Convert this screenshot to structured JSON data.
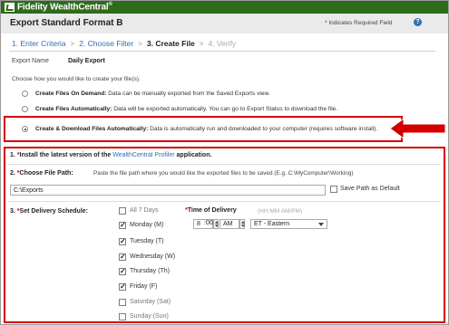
{
  "app": {
    "brand": "Fidelity WealthCentral",
    "brand_suffix": "®"
  },
  "page": {
    "title": "Export Standard Format B",
    "required_note": "Indicates Required Field",
    "help_icon": "?"
  },
  "steps": [
    {
      "label": "1. Enter Criteria",
      "state": "done"
    },
    {
      "label": "2. Choose Filter",
      "state": "done"
    },
    {
      "label": "3. Create File",
      "state": "current"
    },
    {
      "label": "4. Verify",
      "state": "future"
    }
  ],
  "export_name": {
    "label": "Export Name",
    "value": "Daily Export"
  },
  "choose_prompt": "Choose how you would like to create your file(s).",
  "options": [
    {
      "title": "Create Files On Demand:",
      "text": "Data can be manually exported from the Saved Exports view.",
      "selected": false
    },
    {
      "title": "Create Files Automatically:",
      "text": "Data will be exported automatically. You can go to Export Status to download the file.",
      "selected": false
    },
    {
      "title": "Create & Download Files Automatically:",
      "text": "Data is automatically run and downloaded to your computer (requires software install).",
      "selected": true
    }
  ],
  "step1": {
    "num": "1.",
    "text_a": "Install the latest version of the",
    "link": "WealthCentral Profiler",
    "text_b": "application."
  },
  "step2": {
    "num": "2.",
    "label": "Choose File Path:",
    "help": "Paste the file path where you would like the exported files to be saved (E.g. C:\\MyComputer\\Working)",
    "value": "C:\\Exports",
    "save_default": "Save Path as Default"
  },
  "step3": {
    "num": "3.",
    "label": "Set Delivery Schedule:",
    "days": [
      {
        "label": "All 7 Days",
        "checked": false
      },
      {
        "label": "Monday (M)",
        "checked": true
      },
      {
        "label": "Tuesday (T)",
        "checked": true
      },
      {
        "label": "Wednesday (W)",
        "checked": true
      },
      {
        "label": "Thursday (Th)",
        "checked": true
      },
      {
        "label": "Friday (F)",
        "checked": true
      },
      {
        "label": "Saturday (Sat)",
        "checked": false
      },
      {
        "label": "Sunday (Sun)",
        "checked": false
      }
    ],
    "time_label": "Time of Delivery",
    "time_hint": "(HH:MM AM/PM)",
    "hour": "8",
    "minute": ":00",
    "ampm": "AM",
    "timezone": "ET - Eastern"
  },
  "colors": {
    "brand_green": "#2e6b1c",
    "highlight_red": "#d40000",
    "link_blue": "#2f6fb3"
  }
}
